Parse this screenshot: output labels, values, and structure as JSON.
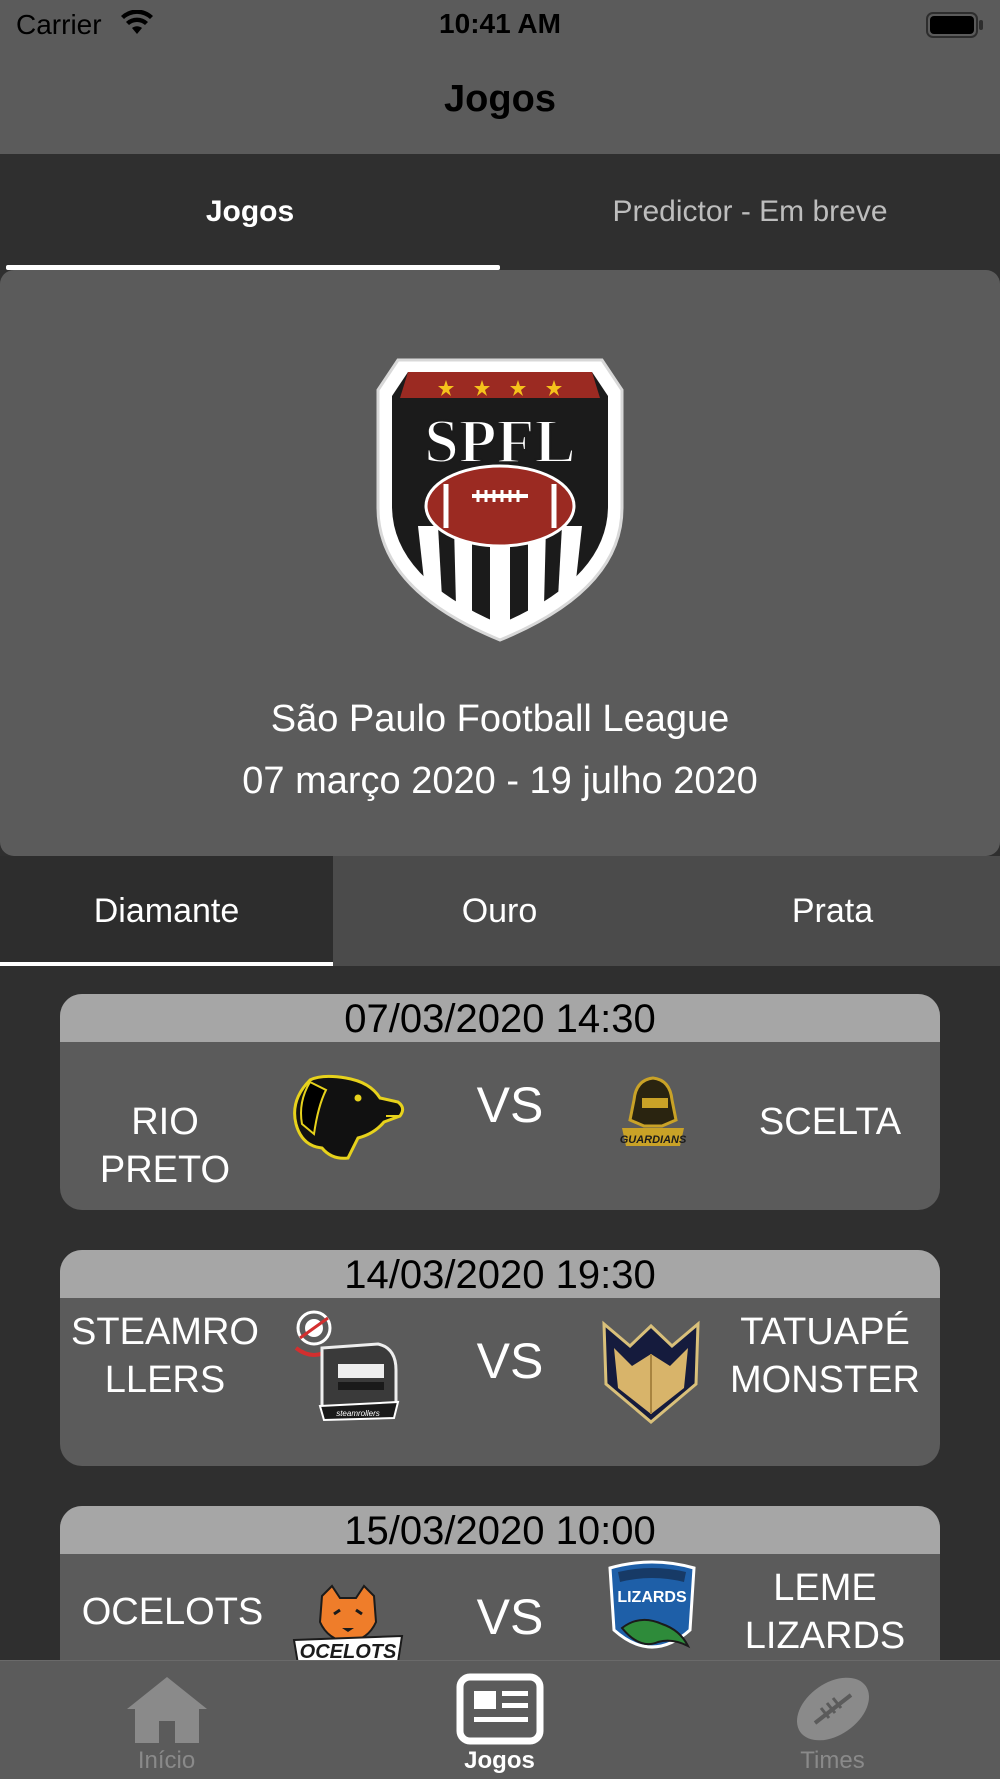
{
  "status_bar": {
    "carrier": "Carrier",
    "time": "10:41 AM"
  },
  "nav": {
    "title": "Jogos"
  },
  "top_tabs": [
    {
      "label": "Jogos",
      "selected": true
    },
    {
      "label": "Predictor - Em breve",
      "selected": false
    }
  ],
  "league": {
    "logo_text": "SPFL",
    "name": "São Paulo Football League",
    "dates": "07 março 2020 - 19 julho 2020"
  },
  "divisions": [
    {
      "label": "Diamante",
      "selected": true
    },
    {
      "label": "Ouro",
      "selected": false
    },
    {
      "label": "Prata",
      "selected": false
    }
  ],
  "games": [
    {
      "datetime": "07/03/2020 14:30",
      "home": "RIO\nPRETO",
      "away": "SCELTA",
      "vs": "VS",
      "home_logo": "dog-logo",
      "away_logo": "guardians-logo",
      "away_logo_text": "GUARDIANS"
    },
    {
      "datetime": "14/03/2020 19:30",
      "home": "STEAMRO\nLLERS",
      "away": "TATUAPÉ\nMONSTER",
      "vs": "VS",
      "home_logo": "steamrollers-logo",
      "away_logo": "monster-logo",
      "home_logo_text": "steamrollers"
    },
    {
      "datetime": "15/03/2020 10:00",
      "home": "OCELOTS",
      "away": "LEME\nLIZARDS",
      "vs": "VS",
      "home_logo": "ocelots-logo",
      "away_logo": "lizards-logo",
      "home_logo_text": "OCELOTS",
      "away_logo_text": "LIZARDS"
    }
  ],
  "tab_bar": [
    {
      "label": "Início",
      "icon": "home-icon",
      "selected": false
    },
    {
      "label": "Jogos",
      "icon": "news-icon",
      "selected": true
    },
    {
      "label": "Times",
      "icon": "football-icon",
      "selected": false
    }
  ],
  "colors": {
    "background": "#2f2f2f",
    "surface": "#5b5b5b",
    "date_header": "#a6a6a6",
    "accent_red": "#9b2a22",
    "star_yellow": "#f5c21b"
  }
}
